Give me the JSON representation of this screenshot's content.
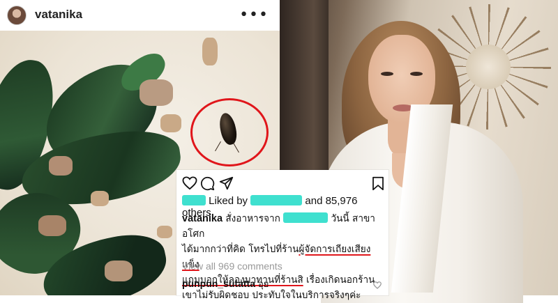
{
  "post": {
    "username": "vatanika",
    "more_glyph": "•••"
  },
  "card": {
    "liked_by_prefix": "Liked by",
    "likes_tail": "and 85,976 others",
    "caption": {
      "user": "vatanika",
      "line1_a": " สั่งอาหารจาก ",
      "line1_b": " วันนี้ สาขาอโศก",
      "line2_a": "ได้มากกว่าที่คิด โทรไปที่ร้าน",
      "line2_b": "ผู้จัดการเถียงเสียงแข็ง",
      "line3_a": "แถมบอกให้ลองมาทานที่ร้านสิ",
      "line3_b": " เรื่องเกิดนอกร้าน",
      "line4": "เขาไม่รับผิดชอบ ประทับใจในบริการจริงๆค่ะ"
    },
    "view_all": "View all 969 comments",
    "comment": {
      "user": "punpun_sutatta",
      "text": "อุย"
    }
  },
  "colors": {
    "highlight_red": "#e0161b",
    "redaction_teal": "#3fe0cf"
  },
  "icons": [
    "heart-icon",
    "comment-icon",
    "share-icon",
    "bookmark-icon",
    "more-icon"
  ]
}
